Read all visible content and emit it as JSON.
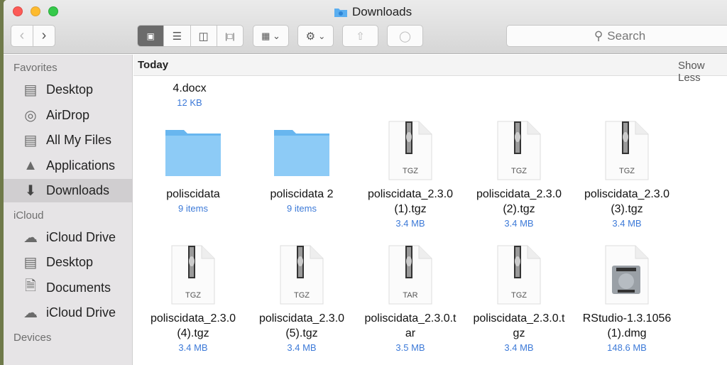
{
  "window": {
    "title": "Downloads"
  },
  "toolbar": {
    "search_placeholder": "Search"
  },
  "sidebar": {
    "sections": [
      {
        "label": "Favorites",
        "items": [
          {
            "label": "Desktop",
            "icon": "desktop-icon"
          },
          {
            "label": "AirDrop",
            "icon": "airdrop-icon"
          },
          {
            "label": "All My Files",
            "icon": "all-files-icon"
          },
          {
            "label": "Applications",
            "icon": "applications-icon"
          },
          {
            "label": "Downloads",
            "icon": "downloads-icon",
            "selected": true
          }
        ]
      },
      {
        "label": "iCloud",
        "items": [
          {
            "label": "iCloud Drive",
            "icon": "cloud-icon"
          },
          {
            "label": "Desktop",
            "icon": "desktop-icon"
          },
          {
            "label": "Documents",
            "icon": "documents-icon"
          },
          {
            "label": "iCloud Drive",
            "icon": "cloud-icon"
          }
        ]
      },
      {
        "label": "Devices",
        "items": []
      }
    ]
  },
  "content": {
    "group": "Today",
    "show_less": "Show Less",
    "partial": {
      "name": "4.docx",
      "size": "12 KB"
    },
    "files": [
      {
        "line1": "poliscidata",
        "line2": "",
        "size": "9 items",
        "type": "folder"
      },
      {
        "line1": "poliscidata 2",
        "line2": "",
        "size": "9 items",
        "type": "folder"
      },
      {
        "line1": "poliscidata_2.3.0",
        "line2": "(1).tgz",
        "size": "3.4 MB",
        "type": "zip",
        "badge": "TGZ"
      },
      {
        "line1": "poliscidata_2.3.0",
        "line2": "(2).tgz",
        "size": "3.4 MB",
        "type": "zip",
        "badge": "TGZ"
      },
      {
        "line1": "poliscidata_2.3.0",
        "line2": "(3).tgz",
        "size": "3.4 MB",
        "type": "zip",
        "badge": "TGZ"
      },
      {
        "line1": "poliscidata_2.3.0",
        "line2": "(4).tgz",
        "size": "3.4 MB",
        "type": "zip",
        "badge": "TGZ"
      },
      {
        "line1": "poliscidata_2.3.0",
        "line2": "(5).tgz",
        "size": "3.4 MB",
        "type": "zip",
        "badge": "TGZ"
      },
      {
        "line1": "poliscidata_2.3.0.t",
        "line2": "ar",
        "size": "3.5 MB",
        "type": "zip",
        "badge": "TAR"
      },
      {
        "line1": "poliscidata_2.3.0.t",
        "line2": "gz",
        "size": "3.4 MB",
        "type": "zip",
        "badge": "TGZ"
      },
      {
        "line1": "RStudio-1.3.1056",
        "line2": "(1).dmg",
        "size": "148.6 MB",
        "type": "dmg"
      }
    ]
  },
  "colors": {
    "accent": "#3d7ad8",
    "folder": "#7cc3f3",
    "selected": "#d0ced0"
  }
}
